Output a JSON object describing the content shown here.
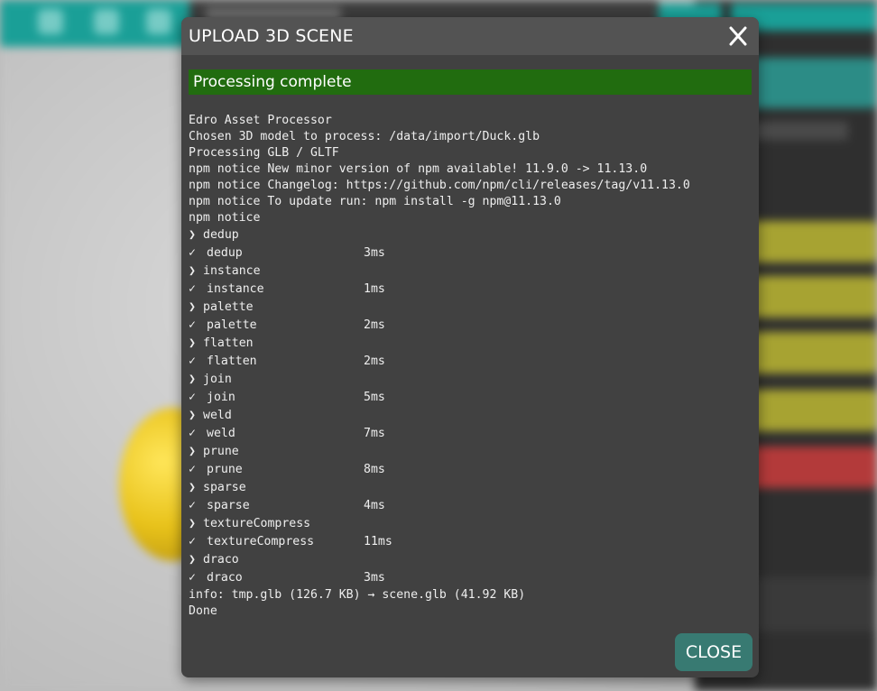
{
  "dialog": {
    "title": "UPLOAD 3D SCENE",
    "status": "Processing complete",
    "close_label": "CLOSE",
    "colors": {
      "status_bg": "#216c0f",
      "close_bg": "#387a72",
      "panel_bg": "#414141"
    }
  },
  "log": {
    "header_lines": [
      "Edro Asset Processor",
      "Chosen 3D model to process: /data/import/Duck.glb",
      "Processing GLB / GLTF",
      "npm notice New minor version of npm available! 11.9.0 -> 11.13.0",
      "npm notice Changelog: https://github.com/npm/cli/releases/tag/v11.13.0",
      "npm notice To update run: npm install -g npm@11.13.0",
      "npm notice"
    ],
    "steps": [
      {
        "name": "dedup",
        "time": "3ms"
      },
      {
        "name": "instance",
        "time": "1ms"
      },
      {
        "name": "palette",
        "time": "2ms"
      },
      {
        "name": "flatten",
        "time": "2ms"
      },
      {
        "name": "join",
        "time": "5ms"
      },
      {
        "name": "weld",
        "time": "7ms"
      },
      {
        "name": "prune",
        "time": "8ms"
      },
      {
        "name": "sparse",
        "time": "4ms"
      },
      {
        "name": "textureCompress",
        "time": "11ms"
      },
      {
        "name": "draco",
        "time": "3ms"
      }
    ],
    "footer_lines": [
      "info: tmp.glb (126.7 KB) → scene.glb (41.92 KB)",
      "Done"
    ],
    "glyphs": {
      "start": "❯",
      "done": "✓"
    }
  }
}
